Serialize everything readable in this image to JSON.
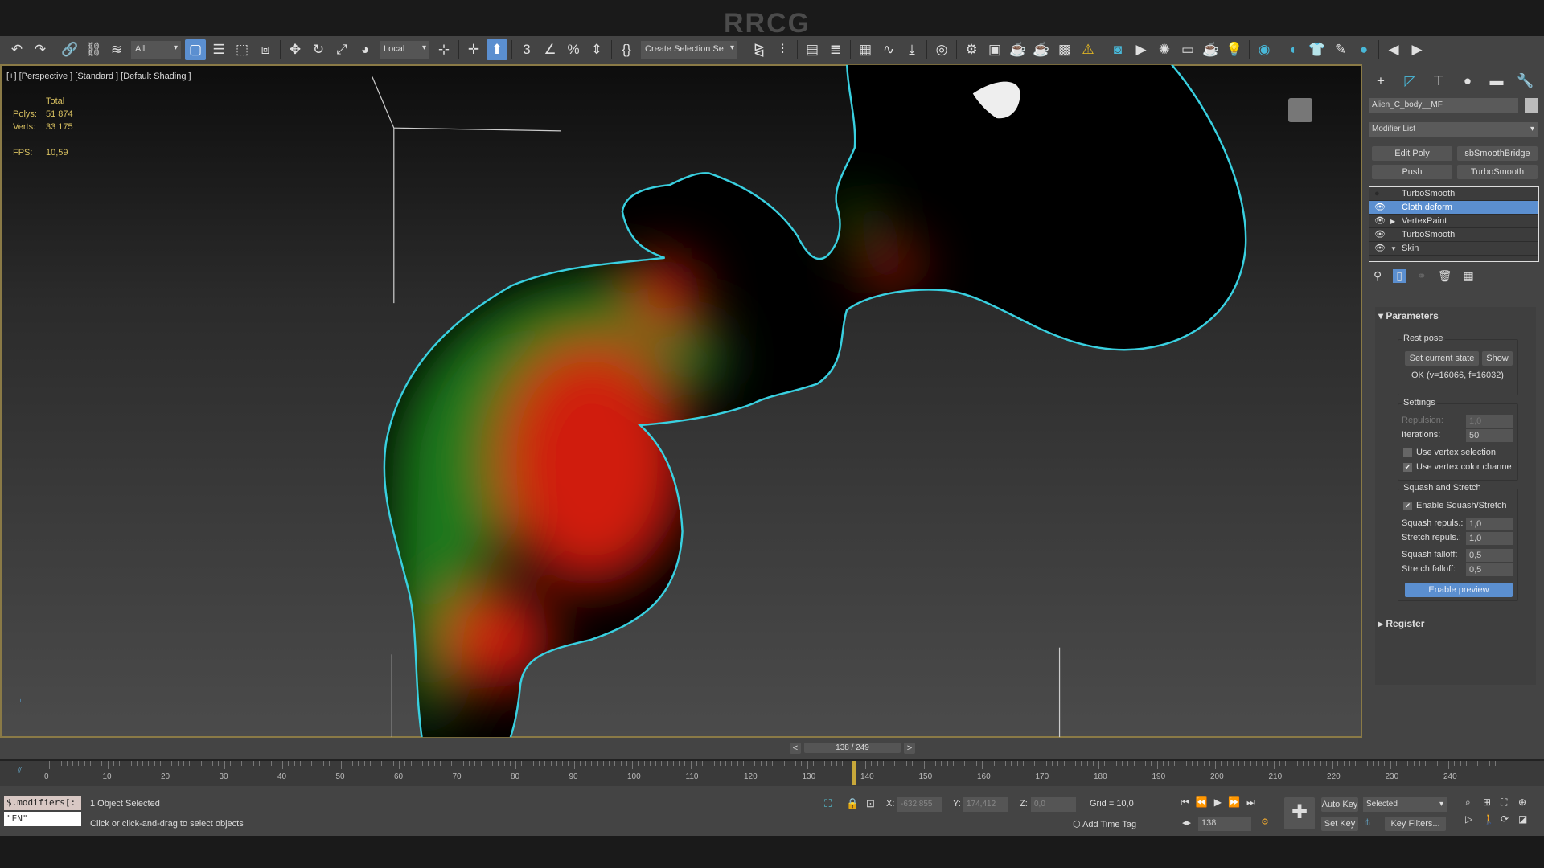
{
  "window_title": "RRCG",
  "toolbar": {
    "selection_filter": "All",
    "coord_system": "Local",
    "named_selection": "Create Selection Se",
    "icons_left": [
      "undo-icon",
      "redo-icon",
      "|",
      "link-icon",
      "unlink-icon",
      "bind-space-warp-icon",
      "#filter",
      "select-object-icon",
      "select-by-name-icon",
      "rect-selection-icon",
      "window-crossing-icon",
      "|",
      "move-icon",
      "rotate-icon",
      "scale-icon",
      "placement-icon",
      "#coord",
      "pivot-icon",
      "|",
      "select-manipulate-icon",
      "keyboard-shortcut-icon",
      "|",
      "snap-3d-icon",
      "angle-snap-icon",
      "percent-snap-icon",
      "spinner-snap-icon",
      "|",
      "edit-named-selection-icon",
      "#named"
    ],
    "icons_right": [
      "mirror-icon",
      "align-icon",
      "|",
      "scene-explorer-icon",
      "layer-explorer-icon",
      "|",
      "toggle-ribbon-icon",
      "curve-editor-icon",
      "dope-sheet-icon",
      "|",
      "material-editor-icon",
      "|",
      "render-setup-icon",
      "rendered-frame-icon",
      "render-production-icon",
      "render-iterative-icon",
      "render-region-icon",
      "warning-icon",
      "|",
      "image-viewer-icon",
      "render-frame-icon",
      "particle-view-icon",
      "window-icon",
      "teapot-icon",
      "light-icon",
      "|",
      "viewport-icon",
      "|",
      "shape-tool-icon",
      "cloth-icon",
      "brush-icon",
      "paint-icon",
      "|",
      "back-icon",
      "play-forward-icon"
    ]
  },
  "viewport": {
    "label": "[+] [Perspective ] [Standard ] [Default Shading ]",
    "stats": {
      "header": "Total",
      "polys_label": "Polys:",
      "polys": "51 874",
      "verts_label": "Verts:",
      "verts": "33 175",
      "fps_label": "FPS:",
      "fps": "10,59"
    },
    "outline_color": "#39d0e0"
  },
  "command_panel": {
    "tabs": [
      "create-icon",
      "modify-icon",
      "hierarchy-icon",
      "motion-icon",
      "display-icon",
      "utilities-icon"
    ],
    "object_name": "Alien_C_body__MF",
    "modifier_list": "Modifier List",
    "quick_buttons": [
      "Edit Poly",
      "sbSmoothBridge",
      "Push",
      "TurboSmooth"
    ],
    "stack": [
      {
        "label": "TurboSmooth",
        "eye": false,
        "arrow": "",
        "selected": false
      },
      {
        "label": "Cloth deform",
        "eye": true,
        "arrow": "",
        "selected": true
      },
      {
        "label": "VertexPaint",
        "eye": true,
        "arrow": "▶",
        "selected": false
      },
      {
        "label": "TurboSmooth",
        "eye": true,
        "arrow": "",
        "selected": false
      },
      {
        "label": "Skin",
        "eye": true,
        "arrow": "▼",
        "selected": false
      }
    ],
    "parameters": {
      "title": "Parameters",
      "rest_pose": {
        "title": "Rest pose",
        "set_current": "Set current state",
        "show": "Show",
        "status": "OK (v=16066, f=16032)"
      },
      "settings": {
        "title": "Settings",
        "repulsion_label": "Repulsion:",
        "repulsion": "1,0",
        "iterations_label": "Iterations:",
        "iterations": "50",
        "use_vertex_selection": "Use vertex selection",
        "use_vertex_selection_checked": false,
        "use_vertex_color": "Use vertex color channe",
        "use_vertex_color_checked": true
      },
      "squash": {
        "title": "Squash and Stretch",
        "enable": "Enable Squash/Stretch",
        "enable_checked": true,
        "squash_repuls_label": "Squash repuls.:",
        "squash_repuls": "1,0",
        "stretch_repuls_label": "Stretch repuls.:",
        "stretch_repuls": "1,0",
        "squash_falloff_label": "Squash falloff:",
        "squash_falloff": "0,5",
        "stretch_falloff_label": "Stretch falloff:",
        "stretch_falloff": "0,5",
        "preview": "Enable preview"
      }
    },
    "register": "Register"
  },
  "timeline": {
    "frame_display": "138 / 249",
    "prev": "<",
    "next": ">",
    "current": 138,
    "end": 249,
    "ticks": [
      0,
      10,
      20,
      30,
      40,
      50,
      60,
      70,
      80,
      90,
      100,
      110,
      120,
      130,
      140,
      150,
      160,
      170,
      180,
      190,
      200,
      210,
      220,
      230,
      240
    ]
  },
  "status": {
    "maxscript_line1": "$.modifiers[:",
    "maxscript_line2": "\"EN\"",
    "selection": "1 Object Selected",
    "prompt": "Click or click-and-drag to select objects",
    "x_label": "X:",
    "x": "-632,855",
    "y_label": "Y:",
    "y": "174,412",
    "z_label": "Z:",
    "z": "0,0",
    "grid": "Grid = 10,0",
    "add_time_tag": "Add Time Tag",
    "frame": "138",
    "auto_key": "Auto Key",
    "set_key": "Set Key",
    "key_mode": "Selected",
    "key_filters": "Key Filters..."
  }
}
